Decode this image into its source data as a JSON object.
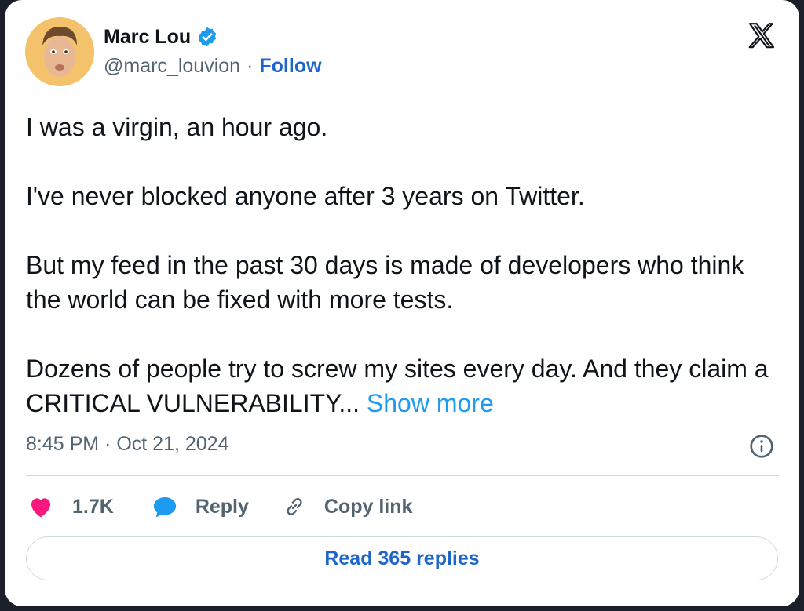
{
  "author": {
    "display_name": "Marc Lou",
    "handle": "@marc_louvion",
    "separator": "·",
    "follow_label": "Follow",
    "verified": true,
    "avatar_bg": "#f4c26b"
  },
  "tweet": {
    "paragraphs": [
      "I was a virgin, an hour ago.",
      "I've never blocked anyone after 3 years on Twitter.",
      "But my feed in the past 30 days is made of developers who think the world can be fixed with more tests.",
      "Dozens of people try to screw my sites every day. And they claim a CRITICAL VULNERABILITY..."
    ],
    "show_more_label": "Show more",
    "timestamp": "8:45 PM · Oct 21, 2024"
  },
  "actions": {
    "like_count": "1.7K",
    "reply_label": "Reply",
    "copy_link_label": "Copy link"
  },
  "footer": {
    "read_replies_label": "Read 365 replies"
  },
  "icons": {
    "platform": "x-logo-icon",
    "verified": "verified-badge-icon",
    "info": "info-icon",
    "like": "heart-icon",
    "reply": "speech-bubble-icon",
    "copy_link": "link-icon"
  },
  "colors": {
    "link_blue": "#1d66c9",
    "show_more_blue": "#1d9bf0",
    "like_pink": "#f91880",
    "reply_blue": "#1d9bf0",
    "secondary_text": "#536471",
    "primary_text": "#0f1419"
  }
}
